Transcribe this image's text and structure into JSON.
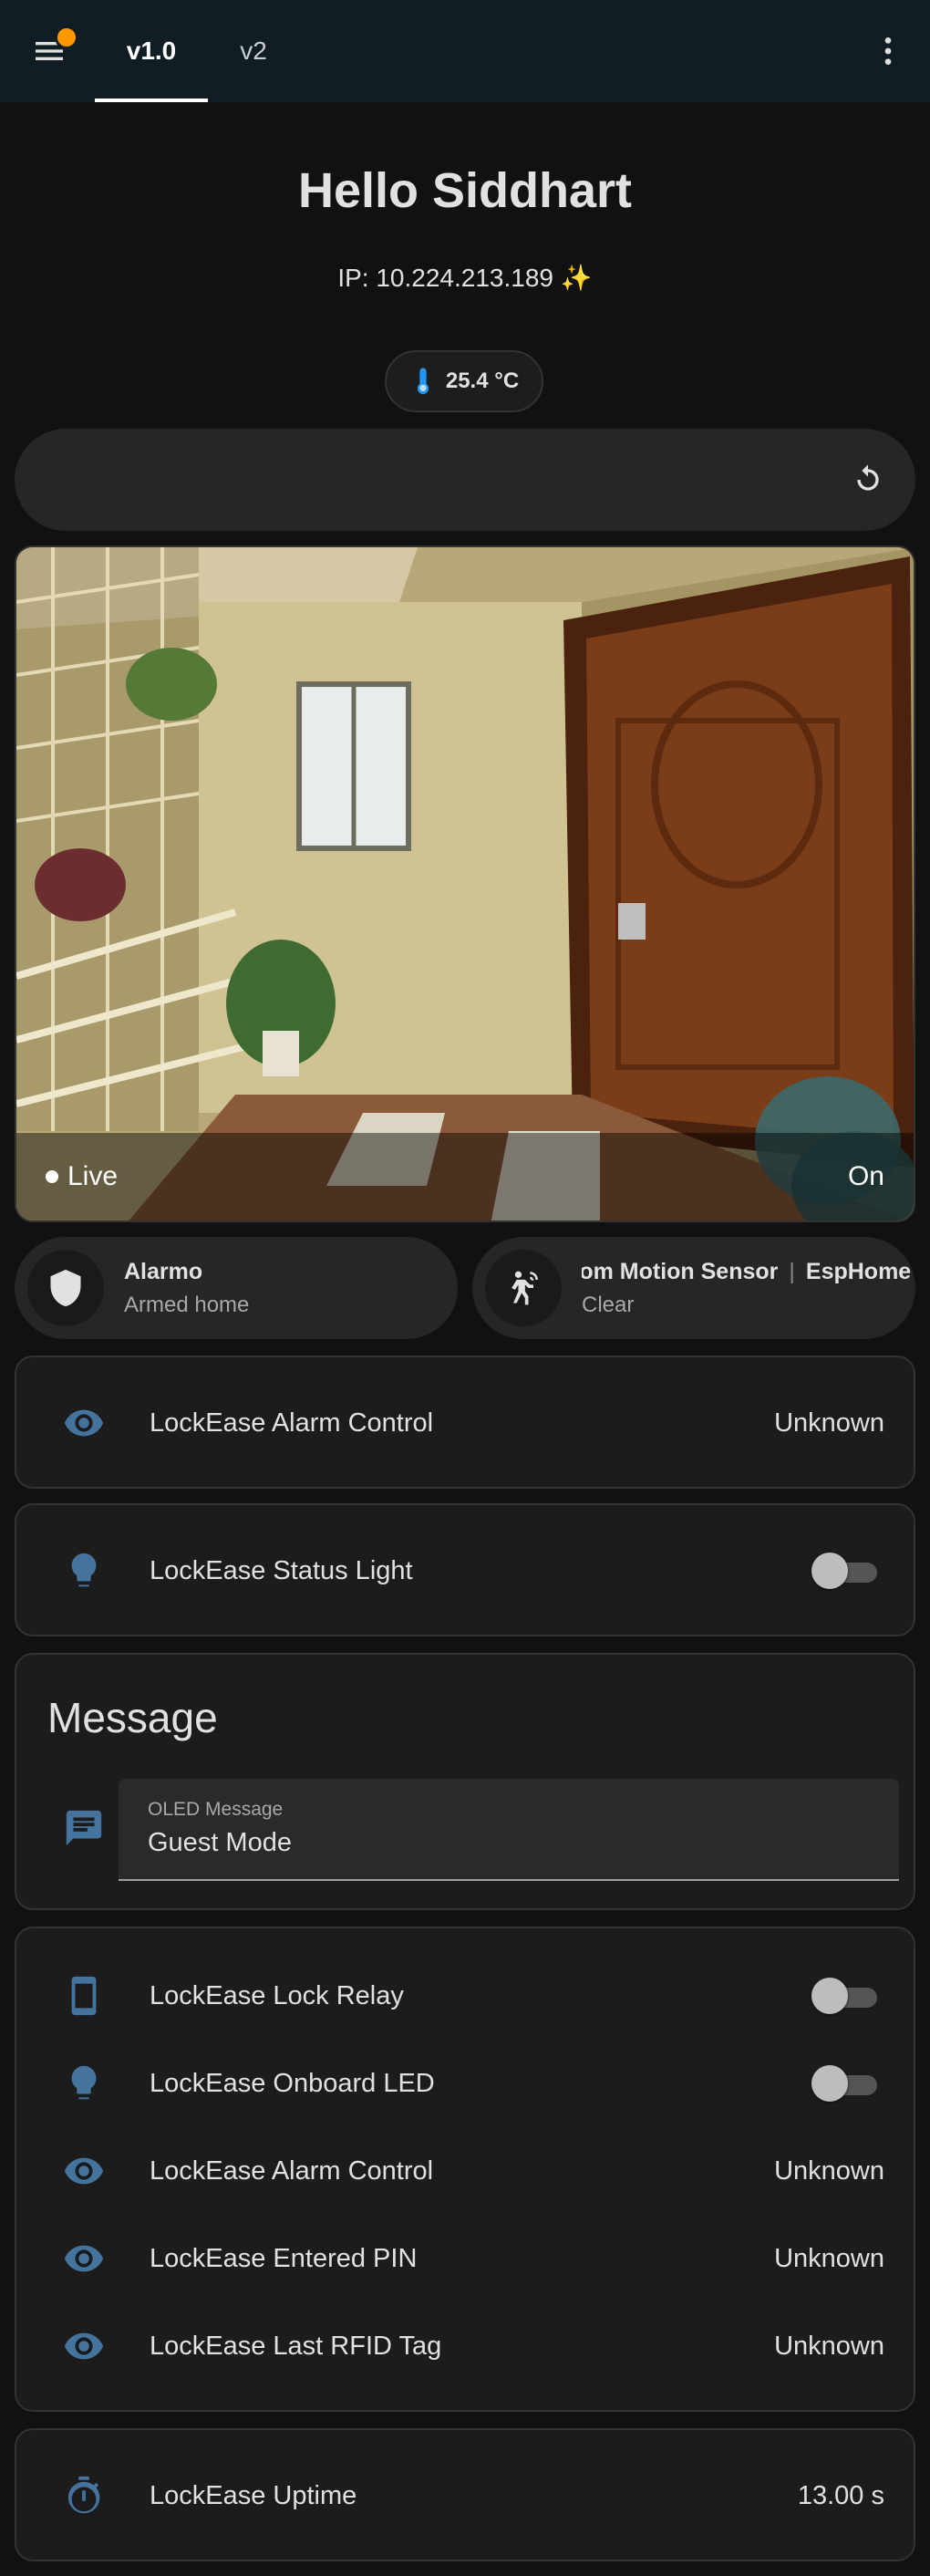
{
  "toolbar": {
    "tabs": [
      {
        "label": "v1.0",
        "active": true
      },
      {
        "label": "v2",
        "active": false
      }
    ],
    "menu_icon": "menu-icon",
    "more_icon": "dots-vertical-icon",
    "notification_color": "#ff9800"
  },
  "header": {
    "greeting": "Hello Siddhart",
    "ip": "IP: 10.224.213.189 ✨",
    "temperature": "25.4 °C"
  },
  "camera": {
    "status": "Live",
    "state": "On"
  },
  "badges": [
    {
      "title": "Alarmo",
      "subtitle": "Armed home",
      "icon": "shield-icon"
    },
    {
      "title": "Room Motion Sensor",
      "title_extra": "EspHome",
      "subtitle": "Clear",
      "icon": "motion-sensor-icon"
    }
  ],
  "cards": {
    "alarm_control": {
      "label": "LockEase Alarm Control",
      "value": "Unknown",
      "icon": "eye-icon"
    },
    "status_light": {
      "label": "LockEase Status Light",
      "state": "off",
      "icon": "lightbulb-icon"
    },
    "message": {
      "title": "Message",
      "field_label": "OLED Message",
      "field_value": "Guest Mode",
      "icon": "message-text-icon"
    },
    "entities": [
      {
        "label": "LockEase Lock Relay",
        "type": "toggle",
        "state": "off",
        "icon": "cellphone-icon"
      },
      {
        "label": "LockEase Onboard LED",
        "type": "toggle",
        "state": "off",
        "icon": "lightbulb-icon"
      },
      {
        "label": "LockEase Alarm Control",
        "type": "value",
        "value": "Unknown",
        "icon": "eye-icon"
      },
      {
        "label": "LockEase Entered PIN",
        "type": "value",
        "value": "Unknown",
        "icon": "eye-icon"
      },
      {
        "label": "LockEase Last RFID Tag",
        "type": "value",
        "value": "Unknown",
        "icon": "eye-icon"
      }
    ],
    "uptime": {
      "label": "LockEase Uptime",
      "value": "13.00 s",
      "icon": "timer-icon"
    }
  },
  "colors": {
    "background": "#111111",
    "topbar": "#101e24",
    "card": "#1c1c1c",
    "icon_blue": "#44739e",
    "text": "#e1e1e1"
  }
}
